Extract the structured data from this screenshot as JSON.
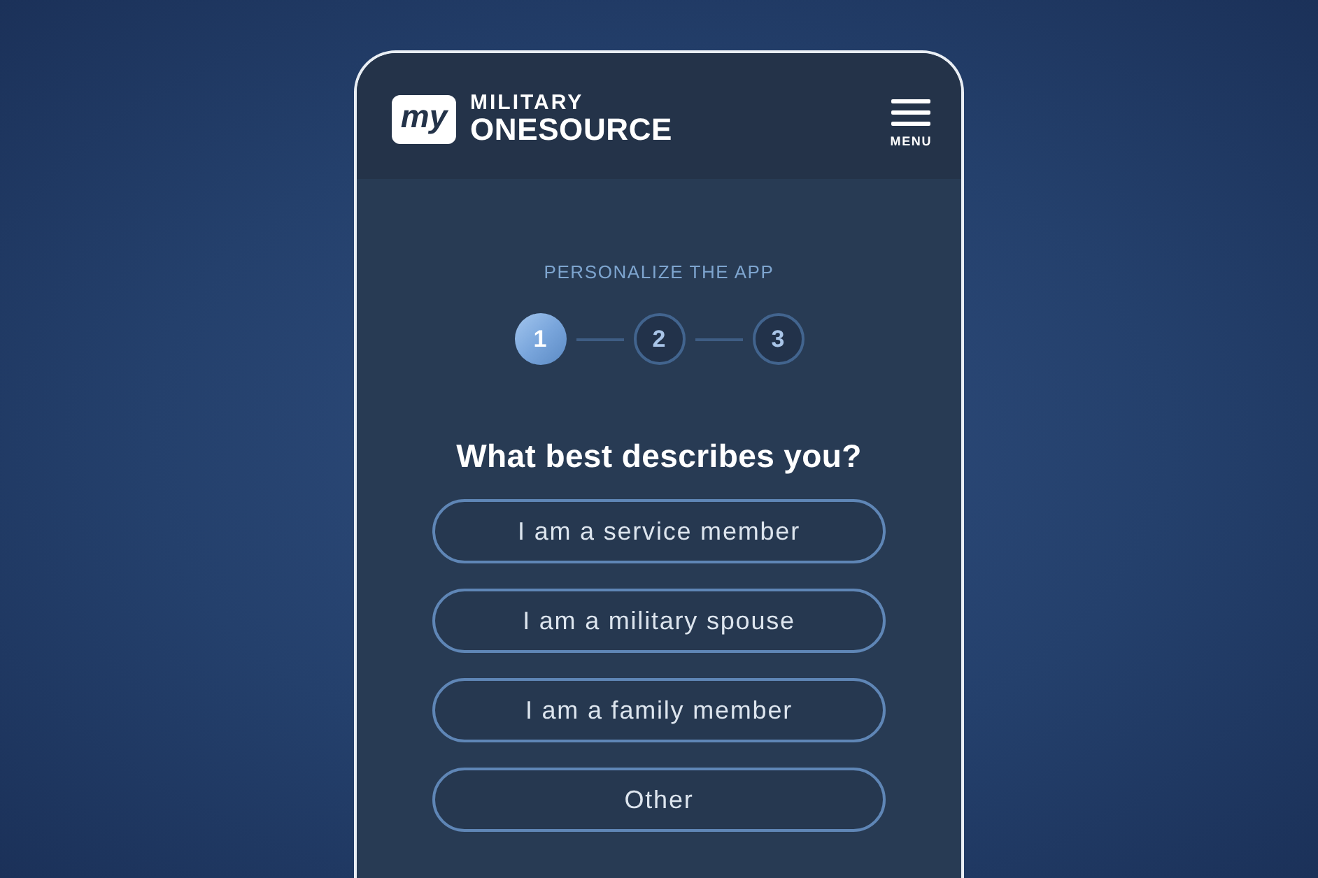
{
  "header": {
    "logo": {
      "badge": "my",
      "line1": "MILITARY",
      "line2": "ONESOURCE"
    },
    "menu": {
      "label": "MENU"
    }
  },
  "stepper": {
    "title": "PERSONALIZE THE APP",
    "steps": [
      {
        "label": "1",
        "selected": true
      },
      {
        "label": "2",
        "selected": false
      },
      {
        "label": "3",
        "selected": false
      }
    ]
  },
  "question": {
    "heading": "What best describes you?",
    "options": [
      {
        "label": "I am a service member"
      },
      {
        "label": "I am a military spouse"
      },
      {
        "label": "I am a family member"
      },
      {
        "label": "Other"
      }
    ]
  }
}
